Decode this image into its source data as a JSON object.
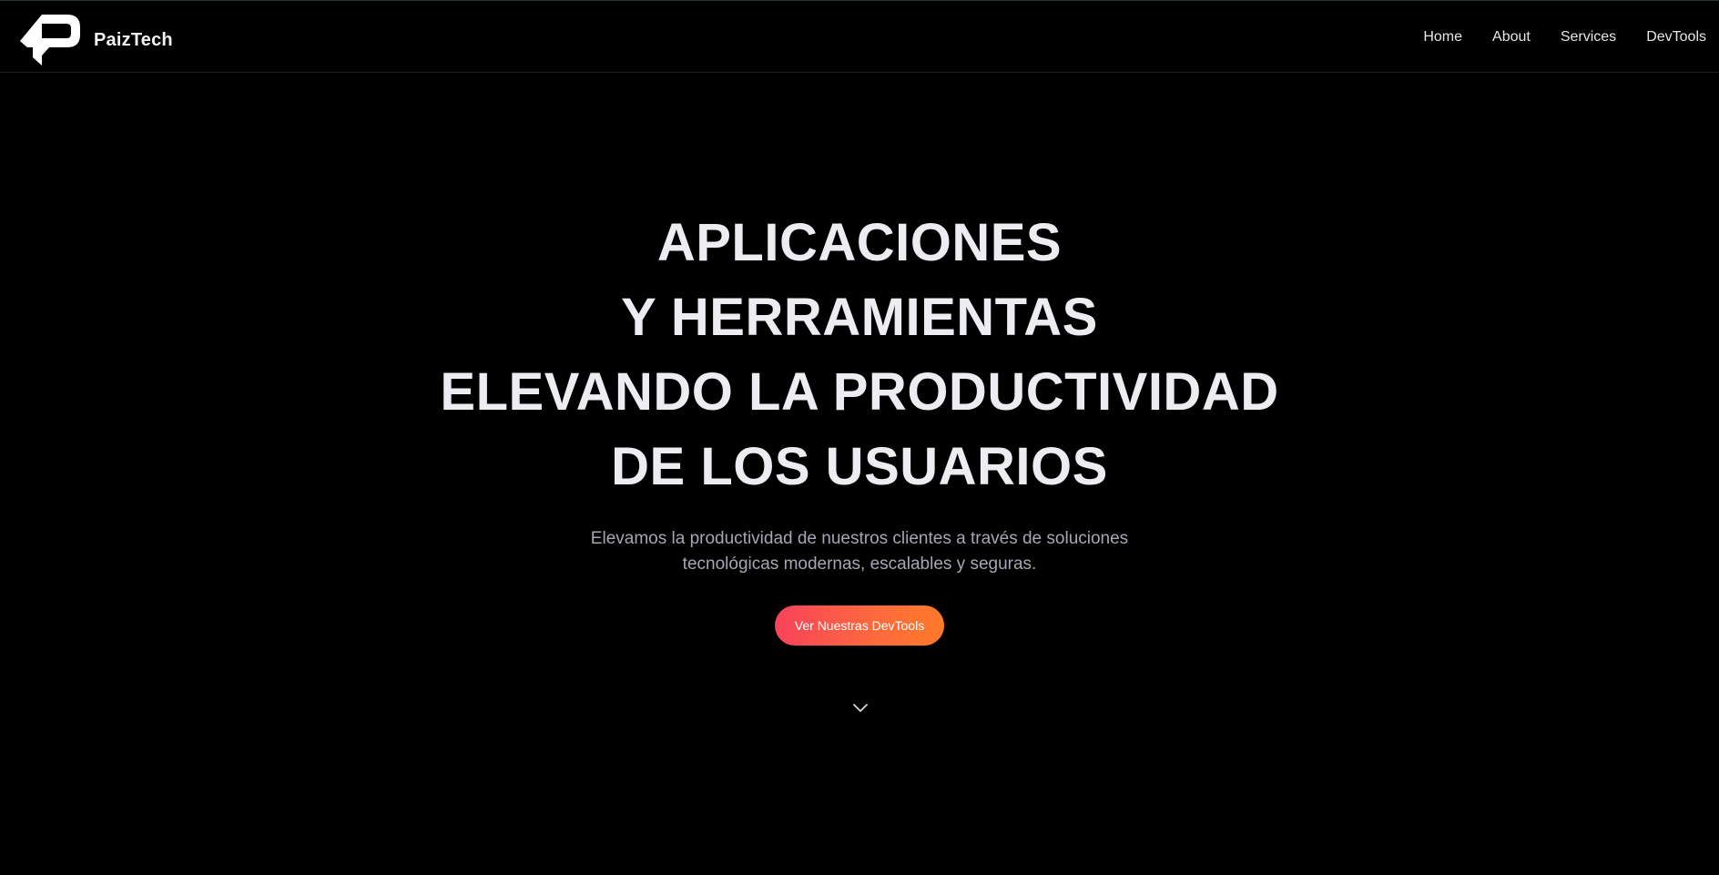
{
  "brand": {
    "name": "PaizTech",
    "logo_icon": "p-logo-icon"
  },
  "nav": {
    "items": [
      {
        "label": "Home"
      },
      {
        "label": "About"
      },
      {
        "label": "Services"
      },
      {
        "label": "DevTools"
      }
    ]
  },
  "hero": {
    "title_lines": [
      "APLICACIONES",
      "Y HERRAMIENTAS",
      "ELEVANDO LA PRODUCTIVIDAD",
      "DE LOS USUARIOS"
    ],
    "subtitle_line1": "Elevamos la productividad de nuestros clientes a través de soluciones",
    "subtitle_line2": "tecnológicas modernas, escalables y seguras.",
    "cta_label": "Ver Nuestras DevTools",
    "scroll_icon": "chevron-down-icon"
  },
  "colors": {
    "background": "#000000",
    "title": "#ececf1",
    "subtitle": "#a6a6b4",
    "cta_gradient_start": "#f8435a",
    "cta_gradient_end": "#ff7a2a"
  }
}
